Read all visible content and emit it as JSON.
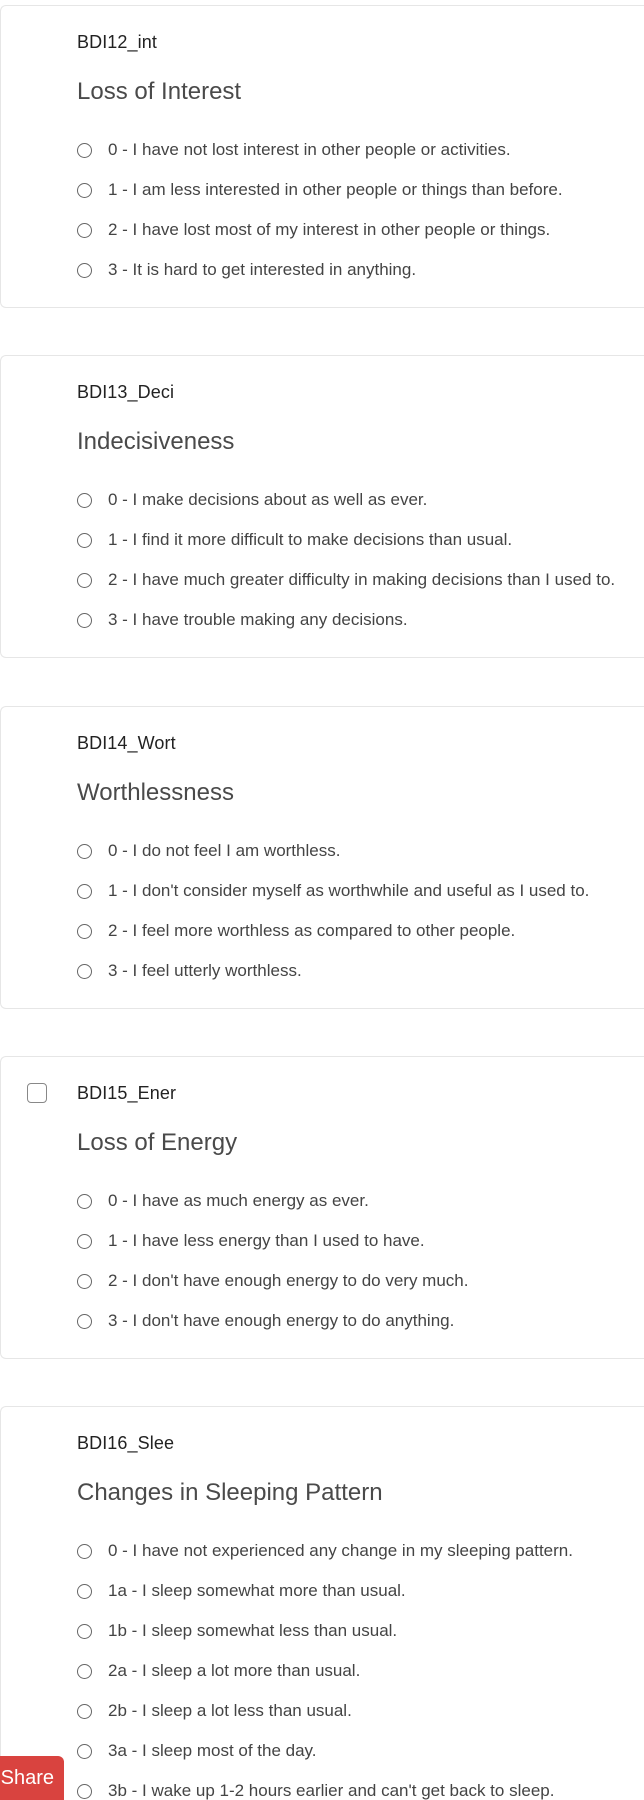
{
  "questions": [
    {
      "id": "BDI12_int",
      "title": "Loss of Interest",
      "options": [
        "0 - I have not lost interest in other people or activities.",
        "1 - I am less interested in other people or things than before.",
        "2 - I have lost most of my interest in other people or things.",
        "3 - It is hard to get interested in anything."
      ]
    },
    {
      "id": "BDI13_Deci",
      "title": "Indecisiveness",
      "options": [
        "0 - I make decisions about as well as ever.",
        "1 - I find it more difficult to make decisions than usual.",
        "2 - I have much greater difficulty in making decisions than I used to.",
        "3 - I have trouble making any decisions."
      ]
    },
    {
      "id": "BDI14_Wort",
      "title": "Worthlessness",
      "options": [
        "0 - I do not feel I am worthless.",
        "1 - I don't consider myself as worthwhile and useful as I used to.",
        "2 - I feel more worthless as compared to other people.",
        "3 - I feel utterly worthless."
      ]
    },
    {
      "id": "BDI15_Ener",
      "title": "Loss of Energy",
      "options": [
        "0 - I have as much energy as ever.",
        "1 - I have less energy than I used to have.",
        "2 - I don't have enough energy to do very much.",
        "3 - I don't have enough energy to do anything."
      ]
    },
    {
      "id": "BDI16_Slee",
      "title": "Changes in Sleeping Pattern",
      "options": [
        "0 - I have not experienced any change in my sleeping pattern.",
        "1a - I sleep somewhat more than usual.",
        "1b - I sleep somewhat less than usual.",
        "2a - I sleep a lot more than usual.",
        "2b - I sleep a lot less than usual.",
        "3a - I sleep most of the day.",
        "3b - I wake up 1-2 hours earlier and can't get back to sleep."
      ]
    }
  ],
  "share_button": {
    "label": "Share"
  }
}
